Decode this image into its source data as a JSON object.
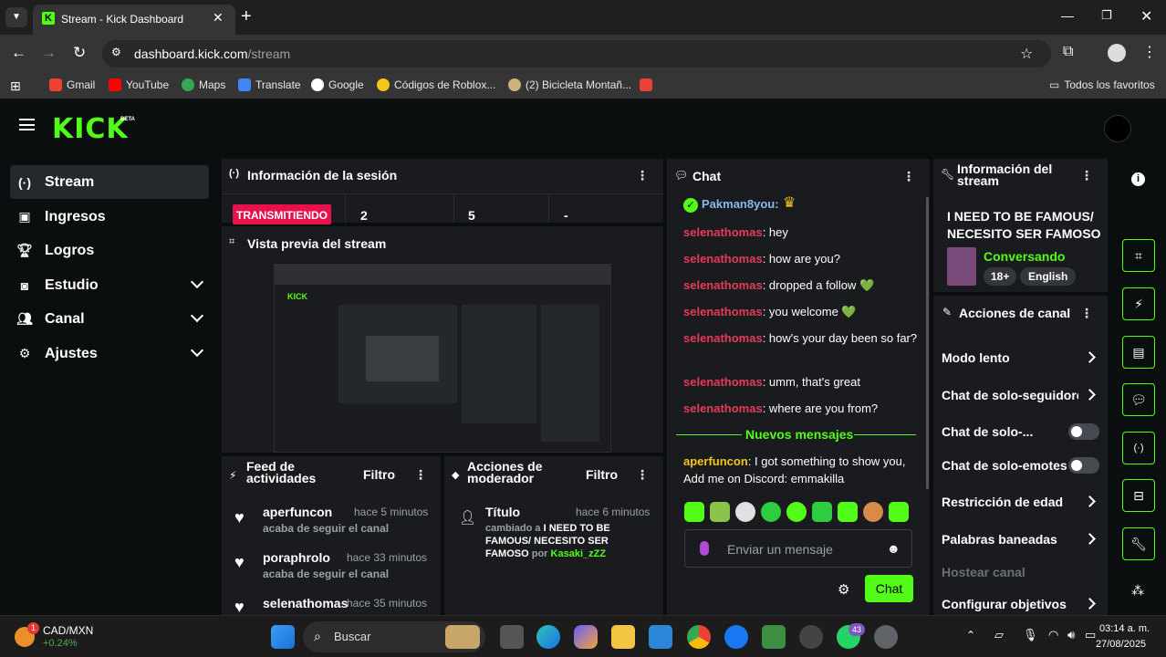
{
  "browser": {
    "tab_title": "Stream - Kick Dashboard",
    "url_host": "dashboard.kick.com",
    "url_path": "/stream",
    "bookmarks": [
      "Gmail",
      "YouTube",
      "Maps",
      "Translate",
      "Google",
      "Códigos de Roblox...",
      "(2) Bicicleta Montañ..."
    ],
    "all_bookmarks": "Todos los favoritos"
  },
  "app": {
    "logo": "KICK",
    "logo_badge": "BETA"
  },
  "sidebar": {
    "items": [
      {
        "label": "Stream",
        "icon": "broadcast-icon"
      },
      {
        "label": "Ingresos",
        "icon": "wallet-icon"
      },
      {
        "label": "Logros",
        "icon": "trophy-icon"
      },
      {
        "label": "Estudio",
        "icon": "studio-icon"
      },
      {
        "label": "Canal",
        "icon": "people-icon"
      },
      {
        "label": "Ajustes",
        "icon": "gear-icon"
      }
    ]
  },
  "session": {
    "title": "Información de la sesión",
    "status": "TRANSMITIENDO",
    "stat1": "2",
    "stat2": "5",
    "stat3": "-"
  },
  "preview": {
    "title": "Vista previa del stream"
  },
  "feed": {
    "title": "Feed de actividades",
    "filter": "Filtro",
    "items": [
      {
        "user": "aperfuncon",
        "time": "hace 5 minutos",
        "action": "acaba de seguir el canal"
      },
      {
        "user": "poraphrolo",
        "time": "hace 33 minutos",
        "action": "acaba de seguir el canal"
      },
      {
        "user": "selenathomas",
        "time": "hace 35 minutos",
        "action": ""
      }
    ]
  },
  "mod": {
    "title": "Acciones de moderador",
    "filter": "Filtro",
    "entry_title": "Título",
    "entry_time": "hace 6 minutos",
    "entry_prefix": "cambiado a",
    "entry_value": "I NEED TO BE FAMOUS/ NECESITO SER FAMOSO",
    "entry_by": "por",
    "entry_user": "Kasaki_zZZ"
  },
  "chat": {
    "title": "Chat",
    "top_user": "Pakman8you:",
    "messages": [
      {
        "user": "selenathomas",
        "text": ": hey"
      },
      {
        "user": "selenathomas",
        "text": ": how are you?"
      },
      {
        "user": "selenathomas",
        "text": ": dropped a follow 💚"
      },
      {
        "user": "selenathomas",
        "text": ": you welcome 💚"
      },
      {
        "user": "selenathomas",
        "text": ": how's your day been so far?"
      },
      {
        "user": "selenathomas",
        "text": ": umm, that's great"
      },
      {
        "user": "selenathomas",
        "text": ": where are you from?"
      }
    ],
    "new_messages": "Nuevos mensajes",
    "last_user": "aperfuncon",
    "last_text": ": I got something to show you, Add me on Discord: emmakilla",
    "placeholder": "Enviar un mensaje",
    "send": "Chat"
  },
  "stream_info": {
    "title": "Información del stream",
    "stream_title": "I NEED TO BE FAMOUS/ NECESITO SER FAMOSO",
    "category": "Conversando",
    "tags": [
      "18+",
      "English"
    ]
  },
  "channel_actions": {
    "title": "Acciones de canal",
    "items": [
      {
        "label": "Modo lento",
        "control": "arrow"
      },
      {
        "label": "Chat de solo-seguidores",
        "control": "arrow"
      },
      {
        "label": "Chat de solo-...",
        "control": "toggle"
      },
      {
        "label": "Chat de solo-emotes",
        "control": "toggle"
      },
      {
        "label": "Restricción de edad",
        "control": "arrow"
      },
      {
        "label": "Palabras baneadas",
        "control": "arrow"
      },
      {
        "label": "Hostear canal",
        "control": "none"
      },
      {
        "label": "Configurar objetivos",
        "control": "arrow"
      }
    ]
  },
  "taskbar": {
    "ticker": "CAD/MXN",
    "ticker_change": "+0.24%",
    "ticker_badge": "1",
    "search": "Buscar",
    "whatsapp_badge": "43",
    "time": "03:14 a. m.",
    "date": "27/08/2025"
  },
  "colors": {
    "accent": "#53fc18",
    "chat_user": "#e53b5a",
    "live": "#e9114c"
  }
}
